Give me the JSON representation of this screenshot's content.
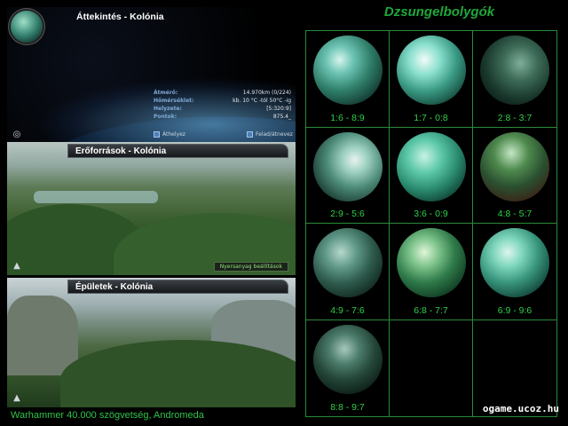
{
  "overview": {
    "title": "Áttekintés - Kolónia",
    "stats": [
      {
        "label": "Átmérő:",
        "value": "14.970km (0/224)"
      },
      {
        "label": "Hőmérséklet:",
        "value": "kb. 10 °C -tól 50°C -ig"
      },
      {
        "label": "Helyzete:",
        "value": "[5:320:9]"
      },
      {
        "label": "Pontok:",
        "value": "875.4_"
      }
    ],
    "relocate_label": "Áthelyez",
    "abandon_label": "Felad/átnevez"
  },
  "resources": {
    "title": "Erőforrások - Kolónia",
    "settings_label": "Nyersanyag beállítások"
  },
  "buildings": {
    "title": "Épületek - Kolónia"
  },
  "footer_left": "Warhammer 40.000 szögvetség, Andromeda",
  "grid_title": "Dzsungelbolygók",
  "planets": [
    {
      "label": "1:6 - 8:9"
    },
    {
      "label": "1:7 - 0:8"
    },
    {
      "label": "2:8 - 3:7"
    },
    {
      "label": "2:9 - 5:6"
    },
    {
      "label": "3:6 - 0:9"
    },
    {
      "label": "4:8 - 5:7"
    },
    {
      "label": "4:9 - 7:6"
    },
    {
      "label": "6:8 - 7:7"
    },
    {
      "label": "6:9 - 9:6"
    },
    {
      "label": "8:8 - 9:7"
    },
    {
      "label": ""
    },
    {
      "label": ""
    }
  ],
  "footer_right": "ogame.ucoz.hu"
}
